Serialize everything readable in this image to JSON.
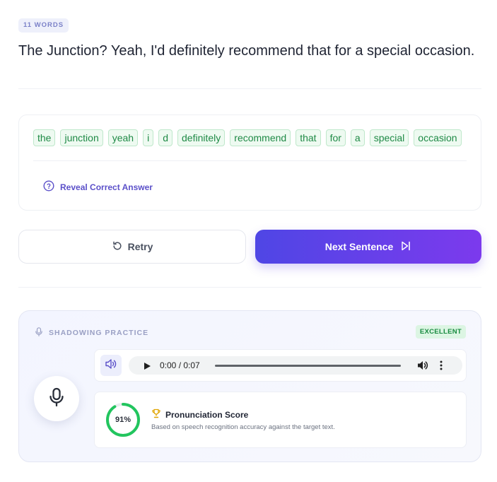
{
  "word_count_badge": "11 WORDS",
  "sentence": "The Junction? Yeah, I'd definitely recommend that for a special occasion.",
  "words": [
    "the",
    "junction",
    "yeah",
    "i",
    "d",
    "definitely",
    "recommend",
    "that",
    "for",
    "a",
    "special",
    "occasion"
  ],
  "reveal_label": "Reveal Correct Answer",
  "retry_label": "Retry",
  "next_label": "Next Sentence",
  "shadowing": {
    "title": "SHADOWING PRACTICE",
    "rating": "EXCELLENT",
    "audio_time": "0:00 / 0:07",
    "score_value": 0.91,
    "score_text": "91%",
    "score_title": "Pronunciation Score",
    "score_desc": "Based on speech recognition accuracy against the target text."
  },
  "colors": {
    "accent_start": "#4f46e5",
    "accent_end": "#7c3aed",
    "chip_green": "#1f8a46",
    "score_ring": "#22c55e"
  },
  "icons": [
    "help-circle-icon",
    "retry-icon",
    "skip-forward-icon",
    "mic-icon",
    "speaker-icon",
    "play-icon",
    "volume-icon",
    "more-vertical-icon",
    "trophy-icon"
  ]
}
